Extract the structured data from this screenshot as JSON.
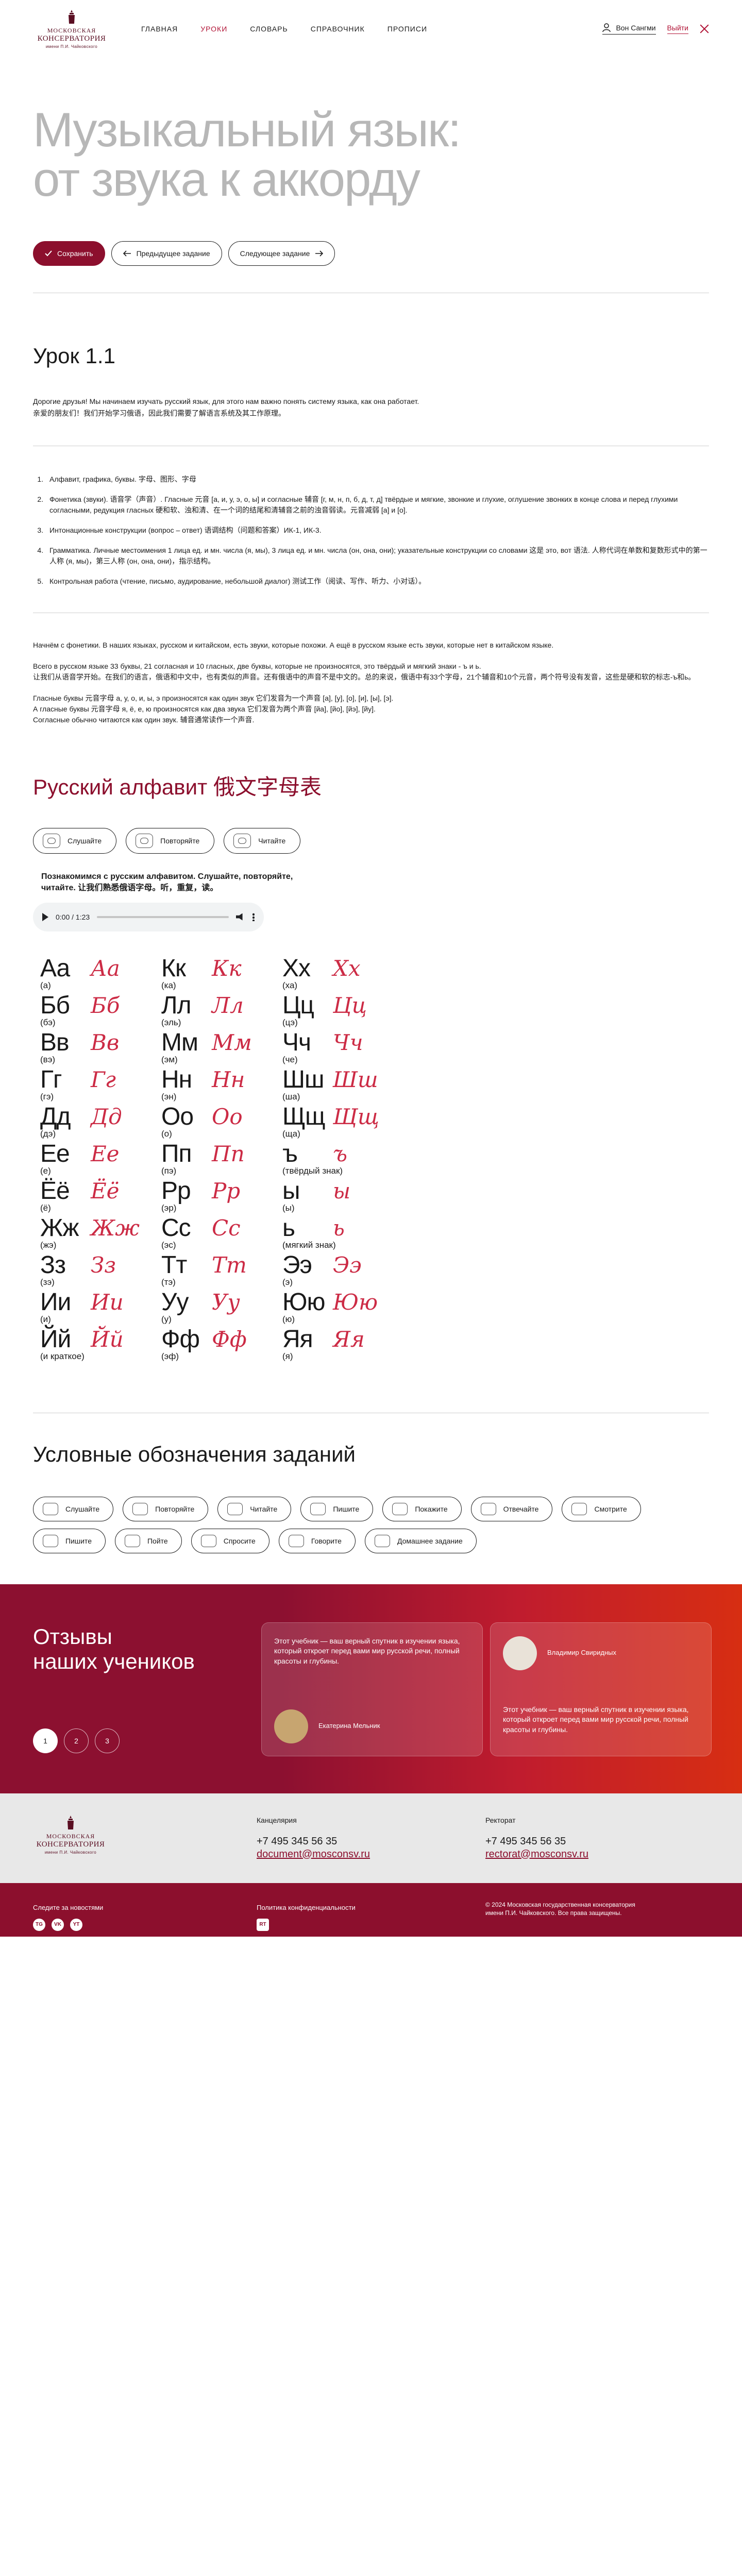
{
  "header": {
    "logo": {
      "line1": "Московская",
      "line2": "Консерватория",
      "line3": "имени П.И. Чайковского"
    },
    "nav": [
      "Главная",
      "Уроки",
      "Словарь",
      "Справочник",
      "Прописи"
    ],
    "active_nav": 1,
    "user_name": "Вон Сангми",
    "logout": "Выйти"
  },
  "hero": {
    "title_line1": "Музыкальный язык:",
    "title_line2": "от звука к аккорду",
    "save": "Сохранить",
    "prev": "Предыдущее задание",
    "next": "Следующее задание"
  },
  "lesson": {
    "title": "Урок 1.1",
    "intro1": "Дорогие друзья! Мы начинаем изучать русский язык, для этого нам важно понять систему языка, как она работает.",
    "intro2": "亲爱的朋友们！我们开始学习俄语，因此我们需要了解语言系统及其工作原理。"
  },
  "outline": [
    "Алфавит, графика, буквы. 字母、图形、字母",
    "Фонетика (звуки). 语音学（声音）. Гласные 元音 [а, и, у, э, о, ы] и согласные 辅音 [г, м, н, п, б, д, т, д] твёрдые и мягкие, звонкие и глухие, оглушение звонких в конце слова и перед глухими согласными, редукция гласных 硬和软、浊和清、在一个词的结尾和清辅音之前的浊音弱读。元音减弱 [а] и [о].",
    "Интонационные конструкции (вопрос – ответ) 语调结构（问题和答案）ИК-1, ИК-3.",
    "Грамматика. Личные местоимения 1 лица ед. и мн. числа (я, мы), 3 лица ед. и мн. числа (он, она, они); указательные конструкции со словами 这是 это, вот 语法. 人称代词在单数和复数形式中的第一人称 (я, мы)，第三人称 (он, она, они)，指示结构。",
    "Контрольная работа (чтение, письмо, аудирование, небольшой диалог) 测试工作（阅读、写作、听力、小对话）。"
  ],
  "notes": [
    "Начнём с фонетики. В наших языках, русском и китайском, есть звуки, которые похожи. А ещё в русском языке есть звуки, которые нет в китайском языке.",
    "Всего в русском языке 33 буквы, 21 согласная и 10 гласных, две буквы, которые не произносятся, это твёрдый и мягкий знаки - ъ и ь.",
    "让我们从语音学开始。在我们的语言，俄语和中文中，也有类似的声音。还有俄语中的声音不是中文的。总的来说，俄语中有33个字母，21个辅音和10个元音，两个符号没有发音，这些是硬和软的标志-ъ和ь。",
    "Гласные буквы 元音字母 а, у, о, и, ы, э произносятся как один звук 它们发音为一个声音 [а], [у], [о], [и], [ы], [э].",
    "А гласные буквы 元音字母 я, ё, е, ю произносятся как два звука 它们发音为两个声音 [йа], [йо], [йэ], [йу].",
    "Согласные обычно читаются как один звук. 辅音通常读作一个声音."
  ],
  "alphabet_section": {
    "title": "Русский алфавит 俄文字母表",
    "actions": [
      "Слушайте",
      "Повторяйте",
      "Читайте"
    ],
    "task_line1": "Познакомимся с русским алфавитом. Слушайте, повторяйте,",
    "task_line2": "читайте. 让我们熟悉俄语字母。听，重复，读。",
    "audio_time": "0:00 / 1:23"
  },
  "alphabet": [
    {
      "p": "Аа",
      "s": "Аа",
      "n": "(а)"
    },
    {
      "p": "Кк",
      "s": "Кк",
      "n": "(ка)"
    },
    {
      "p": "Хх",
      "s": "Хх",
      "n": "(ха)"
    },
    {
      "p": "Бб",
      "s": "Бб",
      "n": "(бэ)"
    },
    {
      "p": "Лл",
      "s": "Лл",
      "n": "(эль)"
    },
    {
      "p": "Цц",
      "s": "Цц",
      "n": "(цэ)"
    },
    {
      "p": "Вв",
      "s": "Вв",
      "n": "(вэ)"
    },
    {
      "p": "Мм",
      "s": "Мм",
      "n": "(эм)"
    },
    {
      "p": "Чч",
      "s": "Чч",
      "n": "(че)"
    },
    {
      "p": "Гг",
      "s": "Гг",
      "n": "(гэ)"
    },
    {
      "p": "Нн",
      "s": "Нн",
      "n": "(эн)"
    },
    {
      "p": "Шш",
      "s": "Шш",
      "n": "(ша)"
    },
    {
      "p": "Дд",
      "s": "Дд",
      "n": "(дэ)"
    },
    {
      "p": "Оо",
      "s": "Оо",
      "n": "(о)"
    },
    {
      "p": "Щщ",
      "s": "Щщ",
      "n": "(ща)"
    },
    {
      "p": "Ее",
      "s": "Ее",
      "n": "(е)"
    },
    {
      "p": "Пп",
      "s": "Пп",
      "n": "(пэ)"
    },
    {
      "p": "ъ",
      "s": "ъ",
      "n": "(твёрдый знак)"
    },
    {
      "p": "Ёё",
      "s": "Ёё",
      "n": "(ё)"
    },
    {
      "p": "Рр",
      "s": "Рр",
      "n": "(эр)"
    },
    {
      "p": "ы",
      "s": "ы",
      "n": "(ы)"
    },
    {
      "p": "Жж",
      "s": "Жж",
      "n": "(жэ)"
    },
    {
      "p": "Сс",
      "s": "Сс",
      "n": "(эс)"
    },
    {
      "p": "ь",
      "s": "ь",
      "n": "(мягкий знак)"
    },
    {
      "p": "Зз",
      "s": "Зз",
      "n": "(зэ)"
    },
    {
      "p": "Тт",
      "s": "Тт",
      "n": "(тэ)"
    },
    {
      "p": "Ээ",
      "s": "Ээ",
      "n": "(э)"
    },
    {
      "p": "Ии",
      "s": "Ии",
      "n": "(и)"
    },
    {
      "p": "Уу",
      "s": "Уу",
      "n": "(у)"
    },
    {
      "p": "Юю",
      "s": "Юю",
      "n": "(ю)"
    },
    {
      "p": "Йй",
      "s": "Йй",
      "n": "(и краткое)"
    },
    {
      "p": "Фф",
      "s": "Фф",
      "n": "(эф)"
    },
    {
      "p": "Яя",
      "s": "Яя",
      "n": "(я)"
    }
  ],
  "conventions": {
    "title": "Условные обозначения заданий",
    "chips": [
      "Слушайте",
      "Повторяйте",
      "Читайте",
      "Пишите",
      "Покажите",
      "Отвечайте",
      "Смотрите",
      "Пишите",
      "Пойте",
      "Спросите",
      "Говорите",
      "Домашнее задание"
    ]
  },
  "reviews": {
    "title_line1": "Отзывы",
    "title_line2": "наших учеников",
    "card1_text": "Этот учебник — ваш верный спутник в изучении языка, который откроет перед вами мир русской речи, полный красоты и глубины.",
    "card1_name": "Екатерина Мельник",
    "card2_name": "Владимир Свиридных",
    "card2_text": "Этот учебник — ваш верный спутник в изучении языка, который откроет перед вами мир русской речи, полный красоты и глубины.",
    "pages": [
      "1",
      "2",
      "3"
    ]
  },
  "footer": {
    "office_title": "Канцелярия",
    "office_phone": "+7 495 345 56 35",
    "office_mail": "document@mosconsv.ru",
    "rector_title": "Ректорат",
    "rector_phone": "+7 495 345 56 35",
    "rector_mail": "rectorat@mosconsv.ru",
    "follow": "Следите за новостями",
    "privacy": "Политика конфиденциальности",
    "copyright1": "© 2024 Московская государственная консерватория",
    "copyright2": "имени П.И. Чайковского. Все права защищены.",
    "social": [
      "TG",
      "VK",
      "YT"
    ],
    "social2": "RT"
  },
  "colors": {
    "accent": "#8c0f2d",
    "script": "#cc2b45",
    "hero_title": "#b7b7b7"
  }
}
